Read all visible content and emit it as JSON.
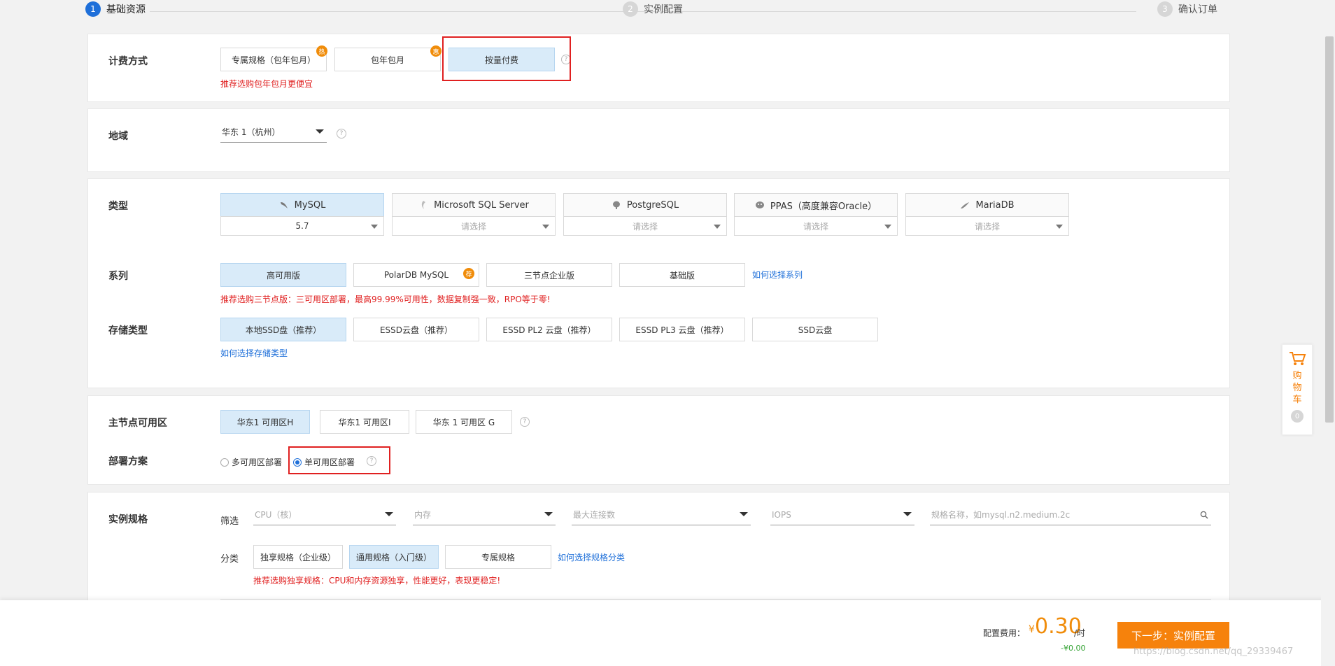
{
  "steps": [
    {
      "num": "1",
      "label": "基础资源"
    },
    {
      "num": "2",
      "label": "实例配置"
    },
    {
      "num": "3",
      "label": "确认订单"
    }
  ],
  "billing": {
    "title": "计费方式",
    "options": [
      {
        "label": "专属规格（包年包月）",
        "badge": "热"
      },
      {
        "label": "包年包月",
        "badge": "惠"
      },
      {
        "label": "按量付费"
      }
    ],
    "note": "推荐选购包年包月更便宜"
  },
  "region": {
    "title": "地域",
    "value": "华东 1（杭州）"
  },
  "dbtype": {
    "title": "类型",
    "engines": [
      {
        "name": "MySQL",
        "version": "5.7",
        "icon": "mysql-dolphin-icon"
      },
      {
        "name": "Microsoft SQL Server",
        "version": "请选择",
        "icon": "sqlserver-icon"
      },
      {
        "name": "PostgreSQL",
        "version": "请选择",
        "icon": "postgres-elephant-icon"
      },
      {
        "name": "PPAS（高度兼容Oracle）",
        "version": "请选择",
        "icon": "ppas-icon"
      },
      {
        "name": "MariaDB",
        "version": "请选择",
        "icon": "mariadb-seal-icon"
      }
    ]
  },
  "series": {
    "title": "系列",
    "options": [
      {
        "label": "高可用版"
      },
      {
        "label": "PolarDB MySQL",
        "badge": "荐"
      },
      {
        "label": "三节点企业版"
      },
      {
        "label": "基础版"
      }
    ],
    "link": "如何选择系列",
    "note": "推荐选购三节点版：三可用区部署，最高99.99%可用性，数据复制强一致，RPO等于零!"
  },
  "storage": {
    "title": "存储类型",
    "options": [
      {
        "label": "本地SSD盘（推荐）"
      },
      {
        "label": "ESSD云盘（推荐）"
      },
      {
        "label": "ESSD PL2 云盘（推荐）"
      },
      {
        "label": "ESSD PL3 云盘（推荐）"
      },
      {
        "label": "SSD云盘"
      }
    ],
    "link": "如何选择存储类型"
  },
  "zone": {
    "title": "主节点可用区",
    "options": [
      {
        "label": "华东1 可用区H"
      },
      {
        "label": "华东1 可用区I"
      },
      {
        "label": "华东 1 可用区 G"
      }
    ]
  },
  "deploy": {
    "title": "部署方案",
    "options": [
      {
        "label": "多可用区部署"
      },
      {
        "label": "单可用区部署"
      }
    ]
  },
  "spec": {
    "title": "实例规格",
    "filter_label": "筛选",
    "filters": [
      {
        "placeholder": "CPU（核）"
      },
      {
        "placeholder": "内存"
      },
      {
        "placeholder": "最大连接数"
      },
      {
        "placeholder": "IOPS"
      }
    ],
    "search_placeholder": "规格名称，如mysql.n2.medium.2c",
    "category_label": "分类",
    "categories": [
      {
        "label": "独享规格（企业级）"
      },
      {
        "label": "通用规格（入门级）"
      },
      {
        "label": "专属规格"
      }
    ],
    "link": "如何选择规格分类",
    "note": "推荐选购独享规格：CPU和内存资源独享，性能更好，表现更稳定!"
  },
  "footer": {
    "fee_label": "配置费用：",
    "currency": "¥",
    "fee_value": "0.30",
    "fee_unit": "/时",
    "discount": "-¥0.00",
    "next_button": "下一步：实例配置",
    "watermark": "https://blog.csdn.net/qq_29339467"
  },
  "cart": {
    "label": "购物车",
    "count": "0"
  },
  "colors": {
    "accent": "#1e6fd9",
    "orange": "#f6820c",
    "selected_bg": "#d9ebf9",
    "note_red": "#e02020"
  }
}
